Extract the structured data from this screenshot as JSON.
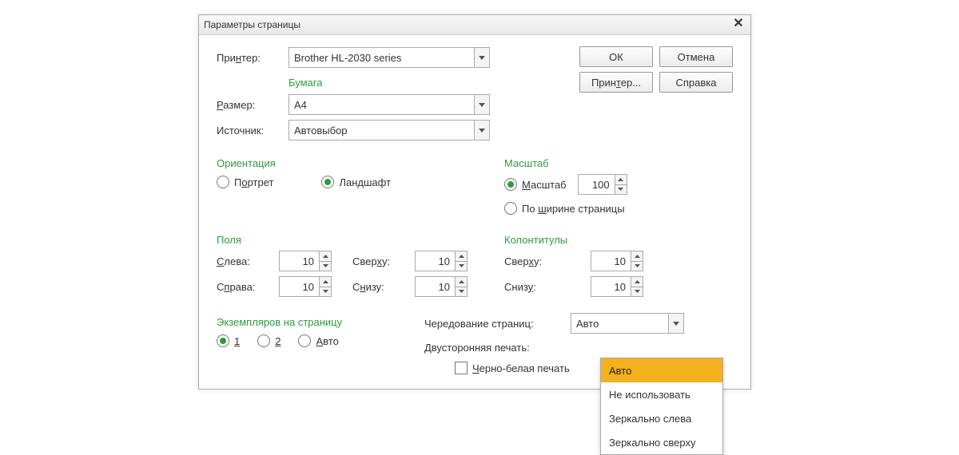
{
  "title": "Параметры страницы",
  "printer_label": "Принтер:",
  "printer_value": "Brother HL-2030 series",
  "buttons": {
    "ok": "ОК",
    "cancel": "Отмена",
    "printer": "Принтер...",
    "help": "Справка"
  },
  "paper": {
    "heading": "Бумага",
    "size_label": "Размер:",
    "size_value": "A4",
    "source_label": "Источник:",
    "source_value": "Автовыбор"
  },
  "orientation": {
    "heading": "Ориентация",
    "portrait": "Портрет",
    "landscape": "Ландшафт",
    "selected": "landscape"
  },
  "scale": {
    "heading": "Масштаб",
    "scale_label": "Масштаб",
    "scale_value": "100",
    "fit_label": "По ширине страницы",
    "selected": "scale"
  },
  "margins": {
    "heading": "Поля",
    "left_label": "Слева:",
    "left_value": "10",
    "right_label": "Справа:",
    "right_value": "10",
    "top_label": "Сверху:",
    "top_value": "10",
    "bottom_label": "Снизу:",
    "bottom_value": "10"
  },
  "headers": {
    "heading": "Колонтитулы",
    "top_label": "Сверху:",
    "top_value": "10",
    "bottom_label": "Снизу:",
    "bottom_value": "10"
  },
  "copies": {
    "heading": "Экземпляров на страницу",
    "opt1": "1",
    "opt2": "2",
    "opt_auto": "Авто",
    "selected": "1"
  },
  "alt": {
    "label": "Чередование страниц:",
    "value": "Авто",
    "options": [
      "Авто",
      "Не использовать",
      "Зеркально слева",
      "Зеркально сверху"
    ]
  },
  "duplex_label": "Двусторонняя печать:",
  "bw_label": "Черно-белая печать"
}
